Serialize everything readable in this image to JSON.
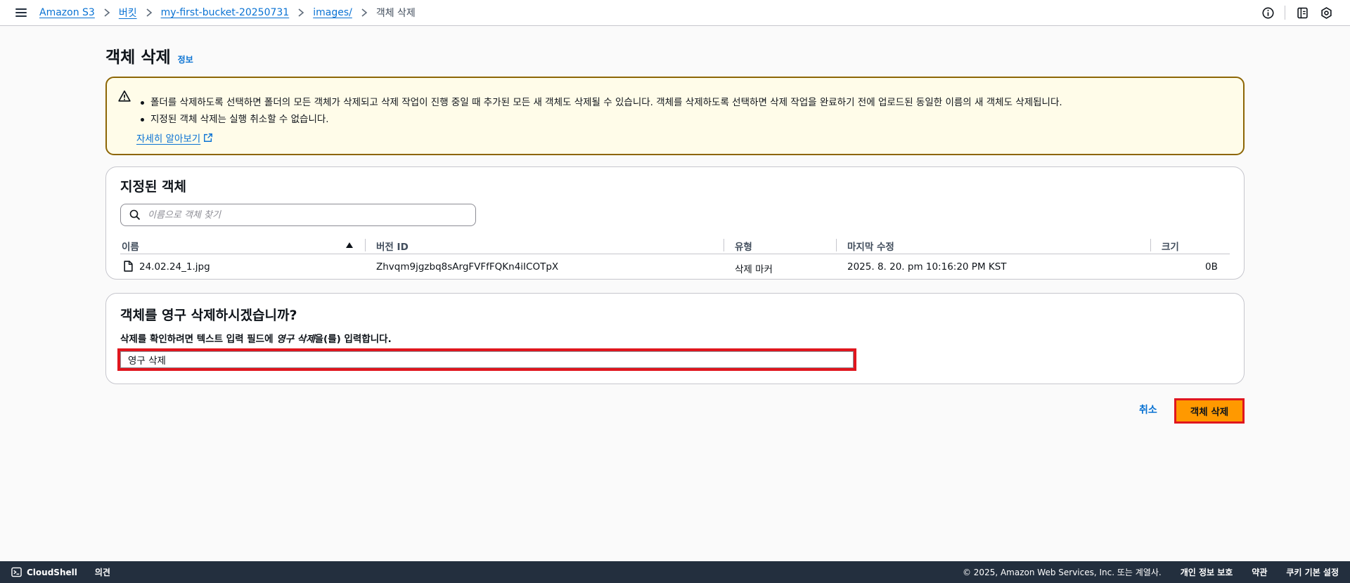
{
  "breadcrumb": {
    "items": [
      "Amazon S3",
      "버킷",
      "my-first-bucket-20250731",
      "images/"
    ],
    "current": "객체 삭제"
  },
  "page": {
    "title": "객체 삭제",
    "info_link": "정보"
  },
  "alert": {
    "bullets": [
      "폴더를 삭제하도록 선택하면 폴더의 모든 객체가 삭제되고 삭제 작업이 진행 중일 때 추가된 모든 새 객체도 삭제될 수 있습니다. 객체를 삭제하도록 선택하면 삭제 작업을 완료하기 전에 업로드된 동일한 이름의 새 객체도 삭제됩니다.",
      "지정된 객체 삭제는 실행 취소할 수 없습니다."
    ],
    "learn_more": "자세히 알아보기"
  },
  "objects": {
    "title": "지정된 객체",
    "search_placeholder": "이름으로 객체 찾기",
    "columns": [
      "이름",
      "버전 ID",
      "유형",
      "마지막 수정",
      "크기"
    ],
    "rows": [
      {
        "name": "24.02.24_1.jpg",
        "version_id": "Zhvqm9jgzbq8sArgFVFfFQKn4iICOTpX",
        "type": "삭제 마커",
        "last_modified": "2025. 8. 20. pm 10:16:20 PM KST",
        "size": "0B"
      }
    ]
  },
  "confirm": {
    "title": "객체를 영구 삭제하시겠습니까?",
    "desc_prefix": "삭제를 확인하려면 텍스트 입력 필드에 ",
    "desc_keyword": "영구 삭제",
    "desc_suffix": "을(를) 입력합니다.",
    "input_value": "영구 삭제"
  },
  "actions": {
    "cancel": "취소",
    "delete": "객체 삭제"
  },
  "footer": {
    "cloudshell": "CloudShell",
    "feedback": "의견",
    "copyright": "© 2025, Amazon Web Services, Inc. 또는 계열사.",
    "privacy": "개인 정보 보호",
    "terms": "약관",
    "cookies": "쿠키 기본 설정"
  },
  "colors": {
    "link": "#0972d3",
    "warning_border": "#8d6605",
    "warning_bg": "#fffce9",
    "primary_button": "#ff9900",
    "highlight": "#e0161e",
    "footer_bg": "#232f3e"
  }
}
